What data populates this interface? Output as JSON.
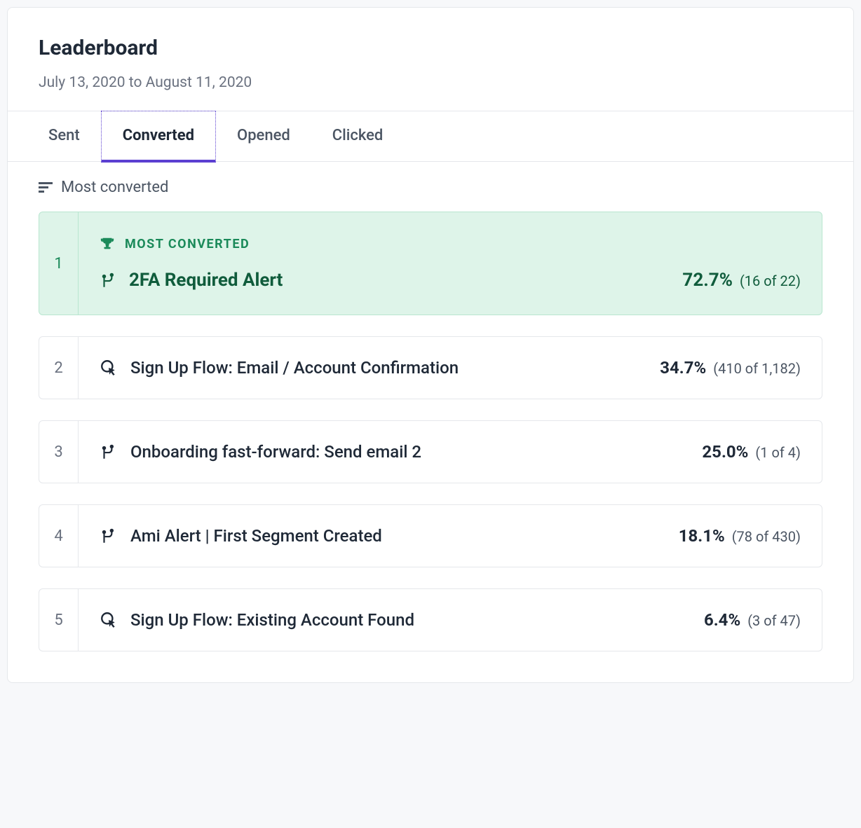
{
  "title": "Leaderboard",
  "date_range": "July 13, 2020 to August 11, 2020",
  "tabs": [
    {
      "label": "Sent",
      "active": false
    },
    {
      "label": "Converted",
      "active": true
    },
    {
      "label": "Opened",
      "active": false
    },
    {
      "label": "Clicked",
      "active": false
    }
  ],
  "sort_label": "Most converted",
  "winner_badge": "MOST CONVERTED",
  "rows": [
    {
      "rank": "1",
      "name": "2FA Required Alert",
      "pct": "72.7%",
      "count": "(16 of 22)",
      "winner": true,
      "icon": "branch"
    },
    {
      "rank": "2",
      "name": "Sign Up Flow: Email / Account Confirmation",
      "pct": "34.7%",
      "count": "(410 of 1,182)",
      "winner": false,
      "icon": "cursor"
    },
    {
      "rank": "3",
      "name": "Onboarding fast-forward: Send email 2",
      "pct": "25.0%",
      "count": "(1 of 4)",
      "winner": false,
      "icon": "branch"
    },
    {
      "rank": "4",
      "name": "Ami Alert | First Segment Created",
      "pct": "18.1%",
      "count": "(78 of 430)",
      "winner": false,
      "icon": "branch"
    },
    {
      "rank": "5",
      "name": "Sign Up Flow: Existing Account Found",
      "pct": "6.4%",
      "count": "(3 of 47)",
      "winner": false,
      "icon": "cursor"
    }
  ]
}
